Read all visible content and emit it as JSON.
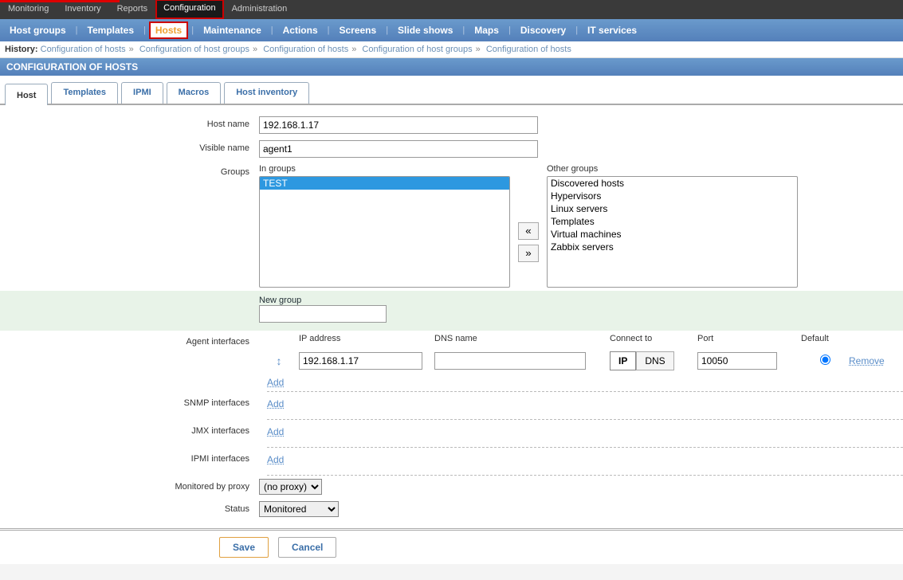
{
  "topnav": {
    "items": [
      "Monitoring",
      "Inventory",
      "Reports",
      "Configuration",
      "Administration"
    ],
    "active": "Configuration"
  },
  "subnav": {
    "items": [
      "Host groups",
      "Templates",
      "Hosts",
      "Maintenance",
      "Actions",
      "Screens",
      "Slide shows",
      "Maps",
      "Discovery",
      "IT services"
    ],
    "active": "Hosts"
  },
  "history": {
    "label": "History:",
    "crumbs": [
      "Configuration of hosts",
      "Configuration of host groups",
      "Configuration of hosts",
      "Configuration of host groups",
      "Configuration of hosts"
    ]
  },
  "page_title": "CONFIGURATION OF HOSTS",
  "tabs": {
    "items": [
      "Host",
      "Templates",
      "IPMI",
      "Macros",
      "Host inventory"
    ],
    "active": "Host"
  },
  "form": {
    "host_name": {
      "label": "Host name",
      "value": "192.168.1.17"
    },
    "visible_name": {
      "label": "Visible name",
      "value": "agent1"
    },
    "groups": {
      "label": "Groups",
      "in_label": "In groups",
      "other_label": "Other groups",
      "in_groups": [
        "TEST"
      ],
      "other_groups": [
        "Discovered hosts",
        "Hypervisors",
        "Linux servers",
        "Templates",
        "Virtual machines",
        "Zabbix servers"
      ],
      "btn_left": "«",
      "btn_right": "»"
    },
    "new_group": {
      "label": "New group",
      "value": ""
    },
    "agent_if": {
      "label": "Agent interfaces",
      "hdr_ip": "IP address",
      "hdr_dns": "DNS name",
      "hdr_conn": "Connect to",
      "hdr_port": "Port",
      "hdr_default": "Default",
      "ip": "192.168.1.17",
      "dns": "",
      "conn_ip": "IP",
      "conn_dns": "DNS",
      "port": "10050",
      "add": "Add",
      "remove": "Remove"
    },
    "snmp_if": {
      "label": "SNMP interfaces",
      "add": "Add"
    },
    "jmx_if": {
      "label": "JMX interfaces",
      "add": "Add"
    },
    "ipmi_if": {
      "label": "IPMI interfaces",
      "add": "Add"
    },
    "proxy": {
      "label": "Monitored by proxy",
      "value": "(no proxy)"
    },
    "status": {
      "label": "Status",
      "value": "Monitored"
    }
  },
  "footer": {
    "save": "Save",
    "cancel": "Cancel"
  }
}
